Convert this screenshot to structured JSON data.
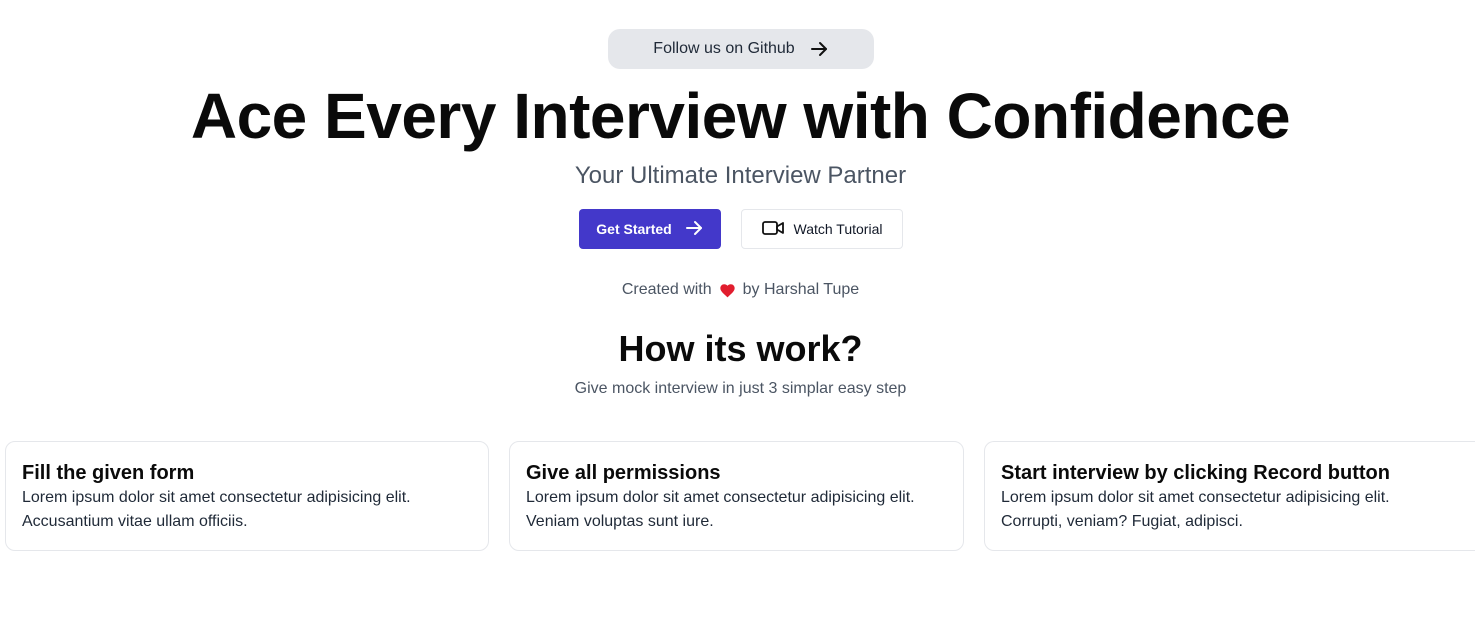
{
  "hero": {
    "github_label": "Follow us on Github",
    "title": "Ace Every Interview with Confidence",
    "subtitle": "Your Ultimate Interview Partner",
    "primary_button": "Get Started",
    "secondary_button": "Watch Tutorial",
    "credit_prefix": "Created with",
    "credit_suffix": "by Harshal Tupe",
    "primary_color": "#4338ca",
    "heart_color": "#e11d2e"
  },
  "how": {
    "title": "How its work?",
    "subtitle": "Give mock interview in just 3 simplar easy step"
  },
  "steps": [
    {
      "title": "Fill the given form",
      "line1": "Lorem ipsum dolor sit amet consectetur adipisicing elit.",
      "line2": "Accusantium vitae ullam officiis."
    },
    {
      "title": "Give all permissions",
      "line1": "Lorem ipsum dolor sit amet consectetur adipisicing elit.",
      "line2": "Veniam voluptas sunt iure."
    },
    {
      "title": "Start interview by clicking Record button",
      "line1": "Lorem ipsum dolor sit amet consectetur adipisicing elit.",
      "line2": "Corrupti, veniam? Fugiat, adipisci."
    }
  ],
  "icons": {
    "github_link": "arrow-right-icon",
    "get_started": "arrow-right-icon",
    "tutorial": "video-camera-icon",
    "credit": "heart-icon"
  }
}
